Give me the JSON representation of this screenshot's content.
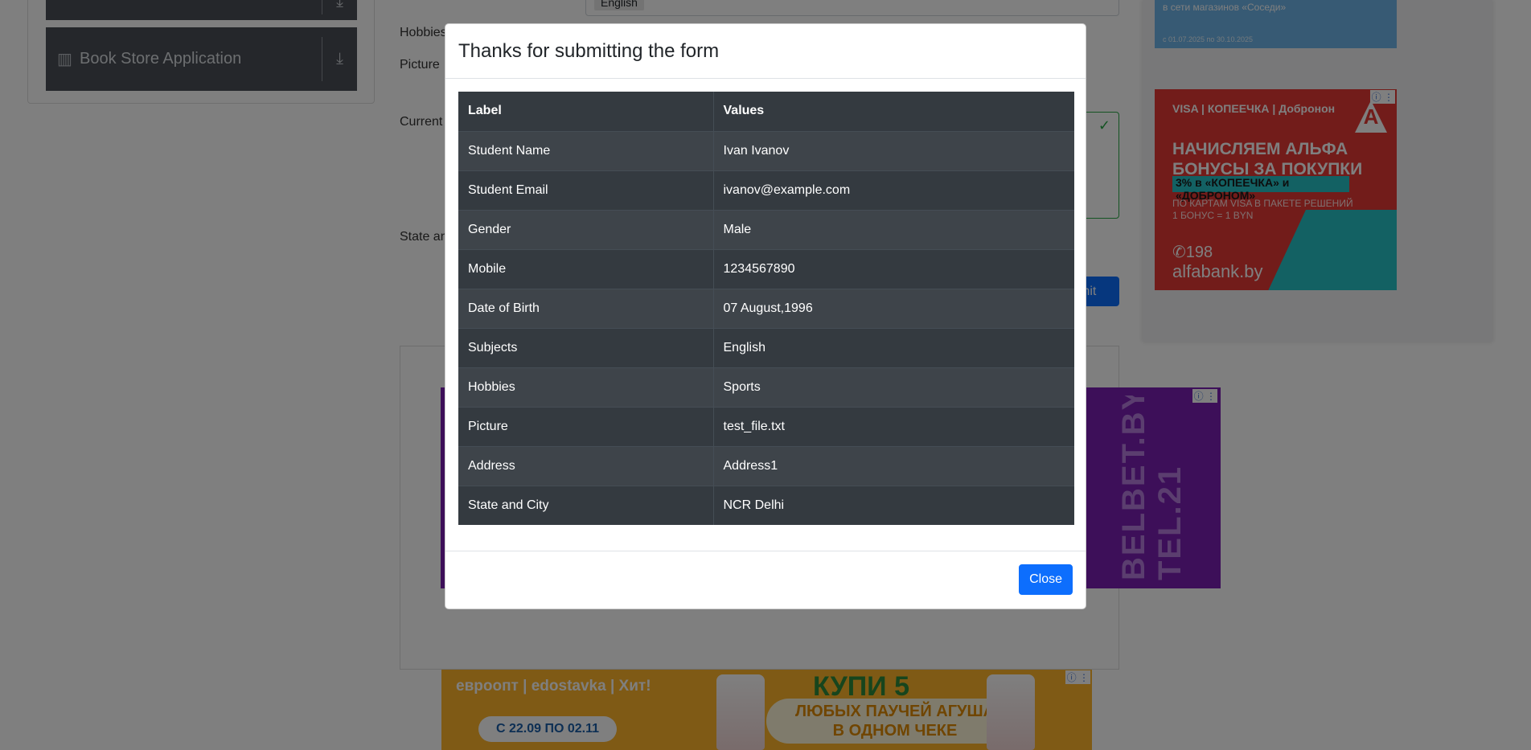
{
  "sidebar": {
    "book_store_label": "Book Store Application"
  },
  "form_bg": {
    "hobbies_label": "Hobbies",
    "picture_label": "Picture",
    "current_label": "Current",
    "state_label": "State an",
    "subject_chip": "English",
    "submit_fragment": "mit"
  },
  "ads": {
    "blue_text": "в сети магазинов «Соседи»",
    "blue_small": "с 01.07.2025 по 30.10.2025",
    "red_brands": "VISA | КОПЕЕЧКА | Добронон",
    "red_headline_1": "НАЧИСЛЯЕМ АЛЬФА",
    "red_headline_2": "БОНУСЫ ЗА ПОКУПКИ",
    "red_bar": "3% в «КОПЕЕЧКА» и «ДОБРОНОМ»",
    "red_sub_1": "ПО КАРТАМ VISA В ПАКЕТЕ РЕШЕНИЙ",
    "red_sub_2": "1 БОНУС = 1 BYN",
    "red_phone": "198",
    "red_site": "alfabank.by",
    "purple_text": "BELBET.BY, TEL.21",
    "bottom_brands": "евроопт | edostavka | Хит!",
    "bottom_dates": "С 22.09 ПО 02.11",
    "bottom_kupi": "КУПИ 5",
    "bottom_promo_1": "ЛЮБЫХ ПАУЧЕЙ АГУША",
    "bottom_promo_2": "В ОДНОМ ЧЕКЕ"
  },
  "modal": {
    "title": "Thanks for submitting the form",
    "headers": {
      "label": "Label",
      "values": "Values"
    },
    "rows": [
      {
        "label": "Student Name",
        "value": "Ivan Ivanov"
      },
      {
        "label": "Student Email",
        "value": "ivanov@example.com"
      },
      {
        "label": "Gender",
        "value": "Male"
      },
      {
        "label": "Mobile",
        "value": "1234567890"
      },
      {
        "label": "Date of Birth",
        "value": "07 August,1996"
      },
      {
        "label": "Subjects",
        "value": "English"
      },
      {
        "label": "Hobbies",
        "value": "Sports"
      },
      {
        "label": "Picture",
        "value": "test_file.txt"
      },
      {
        "label": "Address",
        "value": "Address1"
      },
      {
        "label": "State and City",
        "value": "NCR Delhi"
      }
    ],
    "close_label": "Close"
  },
  "colors": {
    "primary": "#0d6efd",
    "table_dark": "#343a40",
    "overlay": "rgba(0,0,0,0.5)"
  }
}
